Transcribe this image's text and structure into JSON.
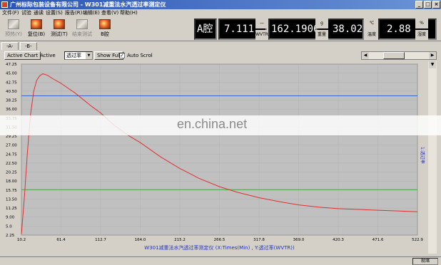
{
  "window": {
    "title": "广州标际包装设备有限公司 - W301减重法水汽透过率测定仪",
    "min": "_",
    "max": "□",
    "close": "×"
  },
  "menu": [
    "文件(F)",
    "试验",
    "通读",
    "设置(S)",
    "报告(R)",
    "编辑(E)",
    "查看(V)",
    "帮助(H)"
  ],
  "toolbar": [
    {
      "label": "预热(Y)",
      "icon": "preheat-icon",
      "enabled": false
    },
    {
      "label": "复位(B)",
      "icon": "reset-icon",
      "enabled": true
    },
    {
      "label": "测试(T)",
      "icon": "test-icon",
      "enabled": true
    },
    {
      "label": "结束测试",
      "icon": "stop-test-icon",
      "enabled": false
    },
    {
      "label": "B腔",
      "icon": "chamber-b-icon",
      "enabled": true
    }
  ],
  "readouts": {
    "chamber": "A腔",
    "value1": "7.111",
    "wvtr": "162.1906",
    "wvtr_unit": "WVTR",
    "weight": "38.02",
    "weight_unit": "重量",
    "weight_unit_symbol": "g",
    "temp": "2.88",
    "temp_unit": "温度",
    "temp_unit_symbol": "℃",
    "humidity_unit_symbol": "%",
    "humidity_unit": "湿度"
  },
  "tabs": [
    "-A-",
    "-B-"
  ],
  "controls": {
    "active_chart": "Active Chart",
    "active": "Active",
    "select_value": "透过率",
    "show_full": "Show Full",
    "auto_scroll": "Auto Scrol",
    "auto_scroll_checked": true
  },
  "watermark": "en.china.net",
  "status": {
    "right": "就绪"
  },
  "colors": {
    "plot_bg": "#c0c0c0",
    "curve": "#e03030",
    "hline_blue": "#3a6ad0",
    "hline_green": "#40b040",
    "axis_label": "#2030c0"
  },
  "chart_data": {
    "type": "line",
    "xlabel": "W301减重法水汽透过率测定仪 (X:Times(Min) , Y:透过率(WVTR))",
    "ylabel_right": "1:透过率",
    "xlim": [
      10.2,
      522.9
    ],
    "ylim": [
      2.25,
      47.25
    ],
    "xticks": [
      "10.2",
      "61.4",
      "112.7",
      "164.0",
      "215.2",
      "266.5",
      "317.8",
      "369.0",
      "420.3",
      "471.6",
      "522.9"
    ],
    "yticks": [
      "2.25",
      "5.0",
      "9.00",
      "11.25",
      "13.50",
      "15.75",
      "18.00",
      "20.25",
      "22.50",
      "24.75",
      "27.00",
      "29.25",
      "31.50",
      "33.75",
      "36.00",
      "38.25",
      "40.50",
      "42.75",
      "45.00",
      "47.25"
    ],
    "hlines": [
      {
        "y": 38.9,
        "color": "blue"
      },
      {
        "y": 14.2,
        "color": "green"
      }
    ],
    "series": [
      {
        "x": [
          10.2,
          14,
          18,
          22,
          26,
          30,
          34,
          38,
          44,
          50,
          61.4,
          80,
          100,
          112.7,
          130,
          150,
          164,
          190,
          215.2,
          240,
          266.5,
          290,
          317.8,
          345,
          369,
          395,
          420.3,
          446,
          471.6,
          497,
          522.9
        ],
        "y": [
          2.5,
          12,
          24,
          34,
          40,
          43,
          44.2,
          44.7,
          44.3,
          43.5,
          42.2,
          39.6,
          36.3,
          34.4,
          31.2,
          28.3,
          26.6,
          22.9,
          19.8,
          17.2,
          15.0,
          13.5,
          12.1,
          11.0,
          10.2,
          9.6,
          9.2,
          9.0,
          8.8,
          8.6,
          8.4
        ]
      }
    ]
  }
}
